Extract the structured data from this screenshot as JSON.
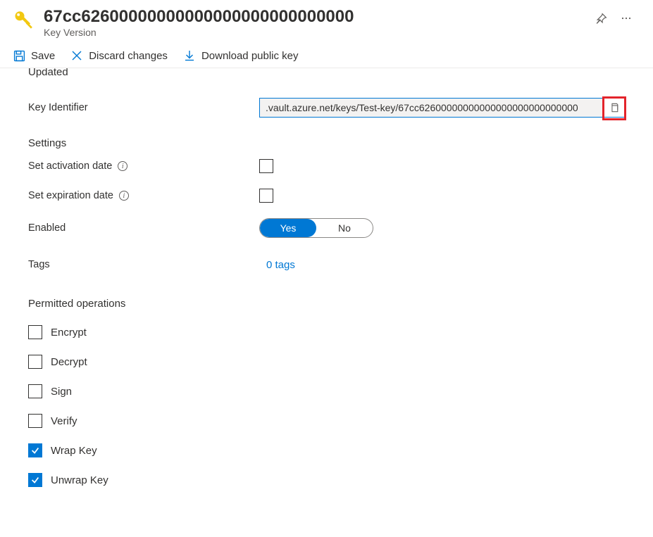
{
  "header": {
    "title": "67cc62600000000000000000000000000",
    "subtitle": "Key Version"
  },
  "toolbar": {
    "save": "Save",
    "discard": "Discard changes",
    "download": "Download public key"
  },
  "content": {
    "updated_label": "Updated",
    "key_identifier_label": "Key Identifier",
    "key_identifier_value": ".vault.azure.net/keys/Test-key/67cc62600000000000000000000000000",
    "settings_heading": "Settings",
    "activation_label": "Set activation date",
    "expiration_label": "Set expiration date",
    "enabled_label": "Enabled",
    "enabled_yes": "Yes",
    "enabled_no": "No",
    "tags_label": "Tags",
    "tags_value": "0 tags",
    "perm_heading": "Permitted operations",
    "perm": {
      "encrypt": "Encrypt",
      "decrypt": "Decrypt",
      "sign": "Sign",
      "verify": "Verify",
      "wrap": "Wrap Key",
      "unwrap": "Unwrap Key"
    }
  }
}
